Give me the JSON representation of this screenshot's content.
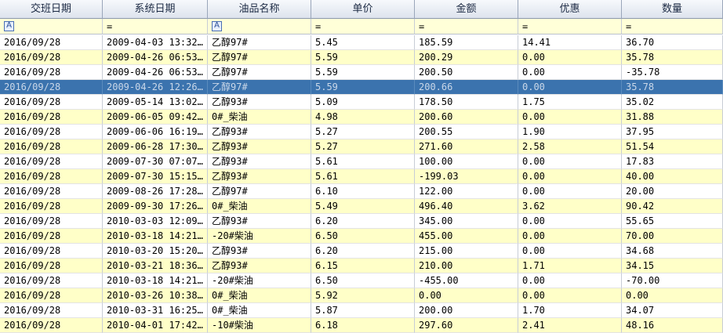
{
  "columns": [
    "交班日期",
    "系统日期",
    "油品名称",
    "单价",
    "金额",
    "优惠",
    "数量"
  ],
  "filters": [
    {
      "icon": "A",
      "value": ""
    },
    {
      "icon": "",
      "value": "="
    },
    {
      "icon": "A",
      "value": ""
    },
    {
      "icon": "",
      "value": "="
    },
    {
      "icon": "",
      "value": "="
    },
    {
      "icon": "",
      "value": "="
    },
    {
      "icon": "",
      "value": "="
    }
  ],
  "selected_row": 3,
  "rows": [
    [
      "2016/09/28",
      "2009-04-03 13:32…",
      "乙醇97#",
      "5.45",
      "185.59",
      "14.41",
      "36.70"
    ],
    [
      "2016/09/28",
      "2009-04-26 06:53…",
      "乙醇97#",
      "5.59",
      "200.29",
      "0.00",
      "35.78"
    ],
    [
      "2016/09/28",
      "2009-04-26 06:53…",
      "乙醇97#",
      "5.59",
      "200.50",
      "0.00",
      "-35.78"
    ],
    [
      "2016/09/28",
      "2009-04-26 12:26…",
      "乙醇97#",
      "5.59",
      "200.66",
      "0.00",
      "35.78"
    ],
    [
      "2016/09/28",
      "2009-05-14 13:02…",
      "乙醇93#",
      "5.09",
      "178.50",
      "1.75",
      "35.02"
    ],
    [
      "2016/09/28",
      "2009-06-05 09:42…",
      "0#_柴油",
      "4.98",
      "200.60",
      "0.00",
      "31.88"
    ],
    [
      "2016/09/28",
      "2009-06-06 16:19…",
      "乙醇93#",
      "5.27",
      "200.55",
      "1.90",
      "37.95"
    ],
    [
      "2016/09/28",
      "2009-06-28 17:30…",
      "乙醇93#",
      "5.27",
      "271.60",
      "2.58",
      "51.54"
    ],
    [
      "2016/09/28",
      "2009-07-30 07:07…",
      "乙醇93#",
      "5.61",
      "100.00",
      "0.00",
      "17.83"
    ],
    [
      "2016/09/28",
      "2009-07-30 15:15…",
      "乙醇93#",
      "5.61",
      "-199.03",
      "0.00",
      "40.00"
    ],
    [
      "2016/09/28",
      "2009-08-26 17:28…",
      "乙醇97#",
      "6.10",
      "122.00",
      "0.00",
      "20.00"
    ],
    [
      "2016/09/28",
      "2009-09-30 17:26…",
      "0#_柴油",
      "5.49",
      "496.40",
      "3.62",
      "90.42"
    ],
    [
      "2016/09/28",
      "2010-03-03 12:09…",
      "乙醇93#",
      "6.20",
      "345.00",
      "0.00",
      "55.65"
    ],
    [
      "2016/09/28",
      "2010-03-18 14:21…",
      "-20#柴油",
      "6.50",
      "455.00",
      "0.00",
      "70.00"
    ],
    [
      "2016/09/28",
      "2010-03-20 15:20…",
      "乙醇93#",
      "6.20",
      "215.00",
      "0.00",
      "34.68"
    ],
    [
      "2016/09/28",
      "2010-03-21 18:36…",
      "乙醇93#",
      "6.15",
      "210.00",
      "1.71",
      "34.15"
    ],
    [
      "2016/09/28",
      "2010-03-18 14:21…",
      "-20#柴油",
      "6.50",
      "-455.00",
      "0.00",
      "-70.00"
    ],
    [
      "2016/09/28",
      "2010-03-26 10:38…",
      "0#_柴油",
      "5.92",
      "0.00",
      "0.00",
      "0.00"
    ],
    [
      "2016/09/28",
      "2010-03-31 16:25…",
      "0#_柴油",
      "5.87",
      "200.00",
      "1.70",
      "34.07"
    ],
    [
      "2016/09/28",
      "2010-04-01 17:42…",
      "-10#柴油",
      "6.18",
      "297.60",
      "2.41",
      "48.16"
    ]
  ]
}
